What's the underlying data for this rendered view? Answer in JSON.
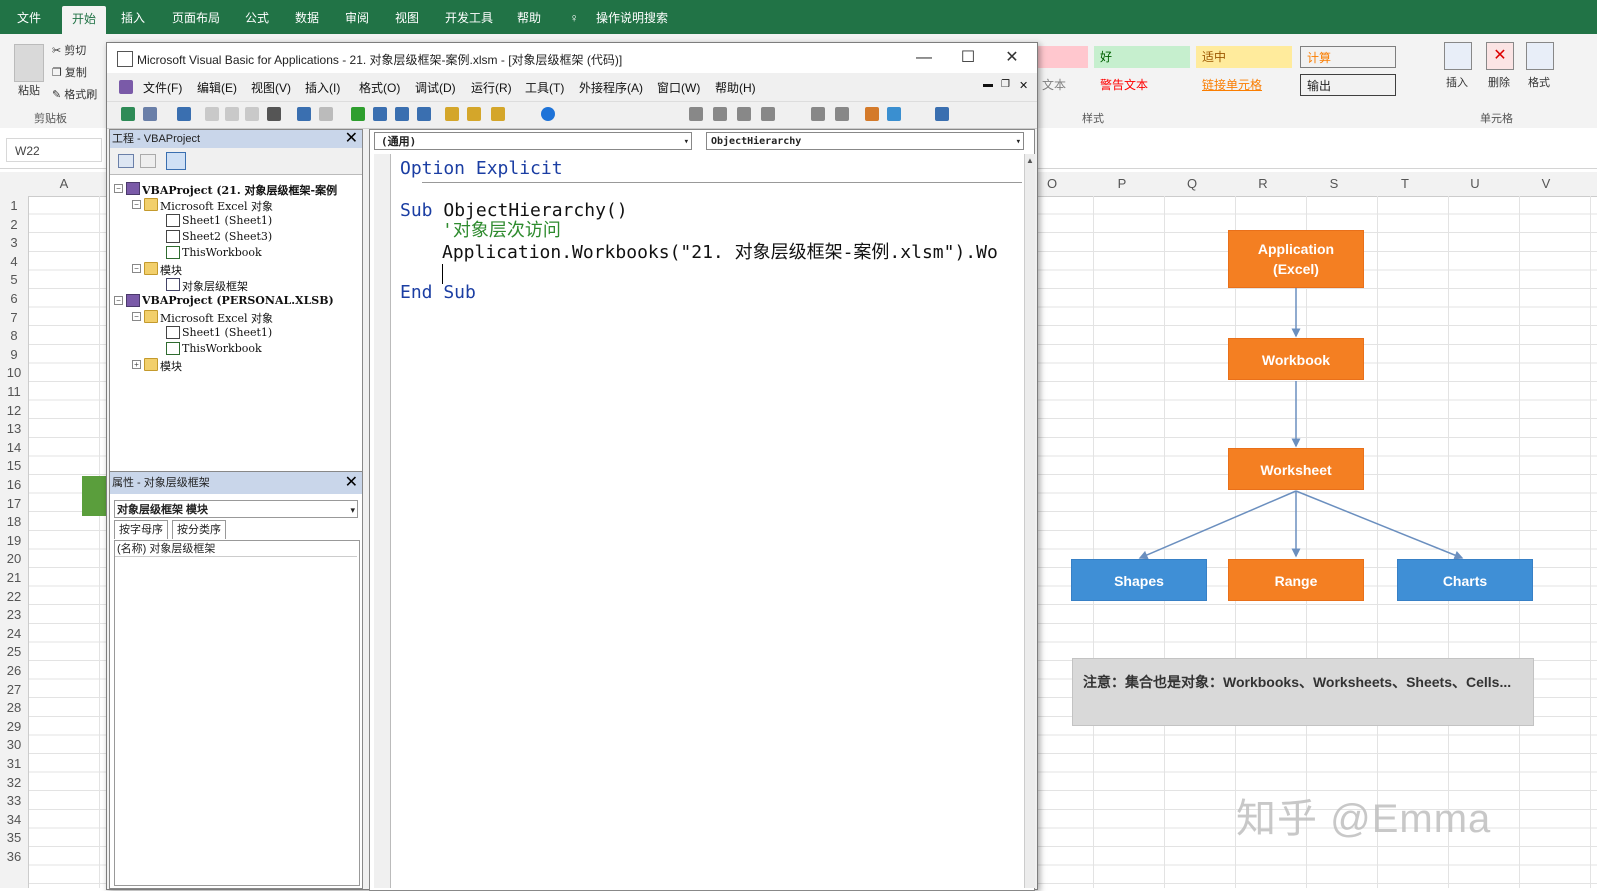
{
  "excel": {
    "ribbon_tabs": [
      "文件",
      "开始",
      "插入",
      "页面布局",
      "公式",
      "数据",
      "审阅",
      "视图",
      "开发工具",
      "帮助",
      "操作说明搜索"
    ],
    "active_tab": "开始",
    "clipboard": {
      "cut": "剪切",
      "copy": "复制",
      "format_painter": "格式刷",
      "paste": "粘贴",
      "group_label": "剪贴板"
    },
    "styles": {
      "cells": [
        "好",
        "适中",
        "计算",
        "文本",
        "警告文本",
        "链接单元格",
        "输出"
      ],
      "group_label": "样式"
    },
    "cells_group": {
      "insert": "插入",
      "delete": "删除",
      "format": "格式",
      "group_label": "单元格"
    },
    "name_box": "W22",
    "columns": [
      "A",
      "O",
      "P",
      "Q",
      "R",
      "S",
      "T",
      "U",
      "V"
    ],
    "rows": [
      "1",
      "2",
      "3",
      "4",
      "5",
      "6",
      "7",
      "8",
      "9",
      "10",
      "11",
      "12",
      "13",
      "14",
      "15",
      "16",
      "17",
      "18",
      "19",
      "20",
      "21",
      "22",
      "23",
      "24",
      "25",
      "26",
      "27",
      "28",
      "29",
      "30",
      "31",
      "32",
      "33",
      "34",
      "35",
      "36"
    ]
  },
  "diagram": {
    "application": "Application\n(Excel)",
    "workbook": "Workbook",
    "worksheet": "Worksheet",
    "shapes": "Shapes",
    "range": "Range",
    "charts": "Charts",
    "note": "注意：集合也是对象：Workbooks、Worksheets、Sheets、Cells..."
  },
  "watermark": "知乎 @Emma",
  "vba": {
    "title": "Microsoft Visual Basic for Applications - 21. 对象层级框架-案例.xlsm - [对象层级框架 (代码)]",
    "menus": [
      "文件(F)",
      "编辑(E)",
      "视图(V)",
      "插入(I)",
      "格式(O)",
      "调试(D)",
      "运行(R)",
      "工具(T)",
      "外接程序(A)",
      "窗口(W)",
      "帮助(H)"
    ],
    "project": {
      "title": "工程 - VBAProject",
      "tree": [
        "VBAProject (21. 对象层级框架-案例",
        "Microsoft Excel 对象",
        "Sheet1 (Sheet1)",
        "Sheet2 (Sheet3)",
        "ThisWorkbook",
        "模块",
        "对象层级框架",
        "VBAProject (PERSONAL.XLSB)",
        "Microsoft Excel 对象",
        "Sheet1 (Sheet1)",
        "ThisWorkbook",
        "模块"
      ]
    },
    "properties": {
      "title": "属性 - 对象层级框架",
      "object": "对象层级框架 模块",
      "tab_alpha": "按字母序",
      "tab_category": "按分类序",
      "name_row": "(名称) 对象层级框架"
    },
    "code": {
      "object_combo": "(通用)",
      "proc_combo": "ObjectHierarchy",
      "lines": {
        "l1": "Option Explicit",
        "l2_kw": "Sub",
        "l2_rest": " ObjectHierarchy()",
        "l3": "'对象层次访问",
        "l4": "Application.Workbooks(\"21. 对象层级框架-案例.xlsm\").Wo",
        "l5_kw": "End Sub"
      }
    }
  }
}
